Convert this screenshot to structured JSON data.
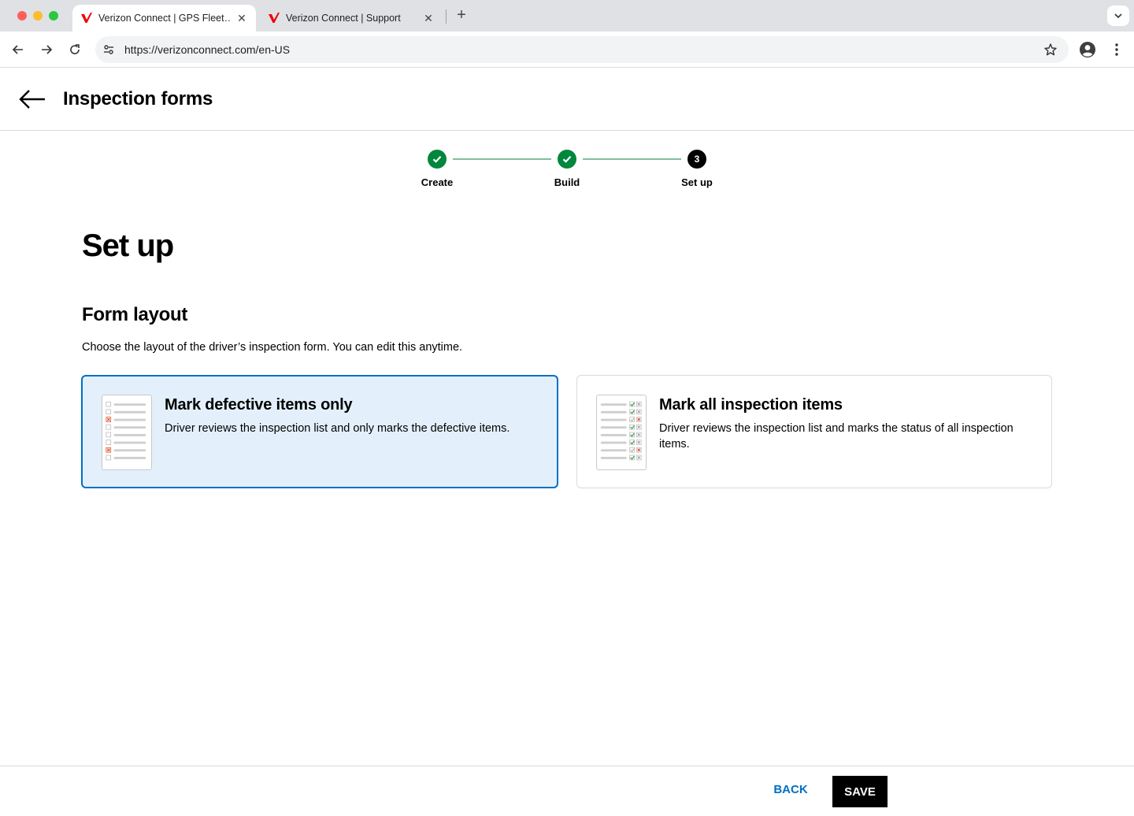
{
  "browser": {
    "tabs": [
      {
        "title": "Verizon Connect | GPS Fleet…",
        "active": true
      },
      {
        "title": "Verizon Connect | Support",
        "active": false
      }
    ],
    "url": "https://verizonconnect.com/en-US"
  },
  "header": {
    "title": "Inspection forms"
  },
  "stepper": {
    "steps": [
      {
        "label": "Create",
        "state": "complete"
      },
      {
        "label": "Build",
        "state": "complete"
      },
      {
        "label": "Set up",
        "state": "current",
        "number": "3"
      }
    ]
  },
  "main": {
    "heading": "Set up",
    "section_title": "Form layout",
    "section_description": "Choose the layout of the driver’s inspection form. You can edit this anytime.",
    "options": [
      {
        "title": "Mark defective items only",
        "description": "Driver reviews the inspection list and only marks the defective items.",
        "selected": true
      },
      {
        "title": "Mark all inspection items",
        "description": "Driver reviews the inspection list and marks the status of all inspection items.",
        "selected": false
      }
    ]
  },
  "footer": {
    "back_label": "BACK",
    "save_label": "SAVE"
  },
  "colors": {
    "brand_red": "#ee0000",
    "success_green": "#00873d",
    "link_blue": "#0070c4",
    "selected_bg": "#e3f0fb"
  }
}
